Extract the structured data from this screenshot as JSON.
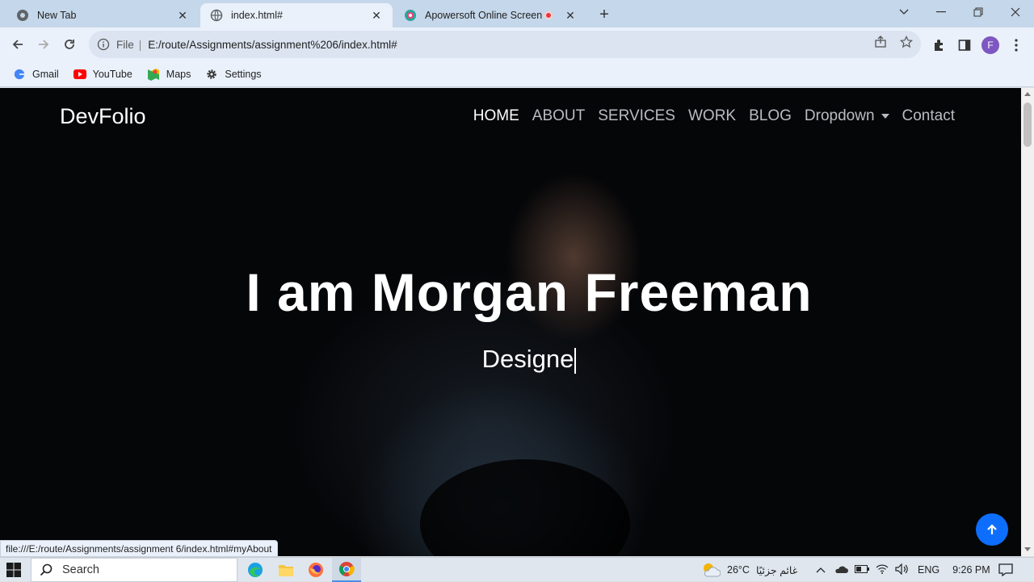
{
  "browser": {
    "tabs": [
      {
        "title": "New Tab",
        "active": false
      },
      {
        "title": "index.html#",
        "active": true
      },
      {
        "title": "Apowersoft Online Screen R",
        "active": false,
        "recording": true
      }
    ],
    "address": {
      "scheme_label": "File",
      "url": "E:/route/Assignments/assignment%206/index.html#"
    },
    "bookmarks": [
      {
        "label": "Gmail",
        "icon": "gmail-icon"
      },
      {
        "label": "YouTube",
        "icon": "youtube-icon"
      },
      {
        "label": "Maps",
        "icon": "maps-icon"
      },
      {
        "label": "Settings",
        "icon": "gear-icon"
      }
    ],
    "profile_initial": "F",
    "status_url": "file:///E:/route/Assignments/assignment 6/index.html#myAbout"
  },
  "site": {
    "brand": "DevFolio",
    "nav": [
      {
        "label": "HOME",
        "active": true
      },
      {
        "label": "ABOUT"
      },
      {
        "label": "SERVICES"
      },
      {
        "label": "WORK"
      },
      {
        "label": "BLOG"
      },
      {
        "label": "Dropdown",
        "dropdown": true
      },
      {
        "label": "Contact"
      }
    ],
    "hero": {
      "title": "I am Morgan Freeman",
      "typed_text": "Designe"
    }
  },
  "taskbar": {
    "search_label": "Search",
    "weather": {
      "temp": "26°C",
      "desc": "غائم جزئيًا"
    },
    "language": "ENG",
    "time": "9:26 PM"
  },
  "colors": {
    "accent": "#0d6efd",
    "page_bg": "#050608",
    "chrome_bg": "#eaf1fb"
  }
}
